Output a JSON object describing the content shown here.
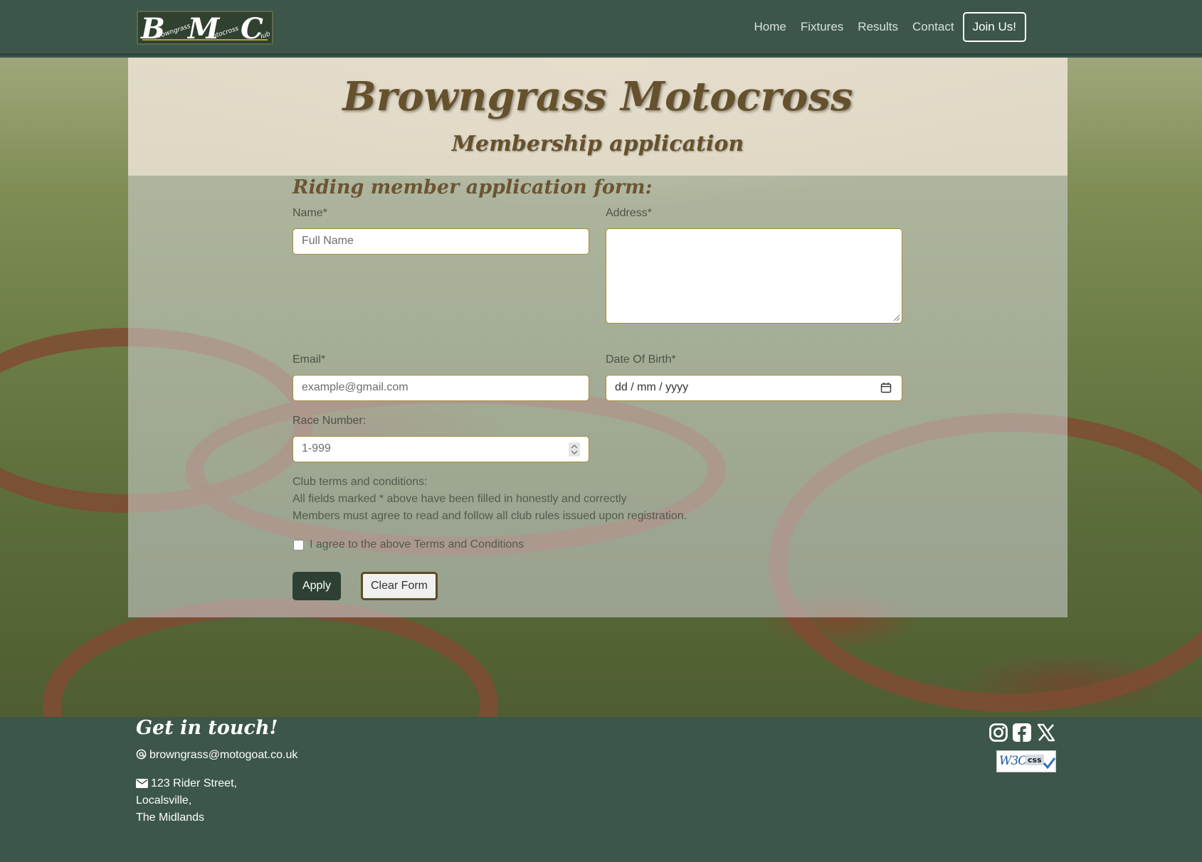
{
  "brand": {
    "logo_B": "B",
    "logo_rowngrass": "rowngrass",
    "logo_M": "M",
    "logo_otocross": "otocross",
    "logo_C": "C",
    "logo_lub": "lub"
  },
  "nav": {
    "links": [
      "Home",
      "Fixtures",
      "Results",
      "Contact"
    ],
    "join_label": "Join Us!"
  },
  "hero": {
    "title": "Browngrass Motocross",
    "subtitle": "Membership application"
  },
  "form": {
    "heading": "Riding member application form:",
    "name_label": "Name*",
    "name_placeholder": "Full Name",
    "address_label": "Address*",
    "email_label": "Email*",
    "email_placeholder": "example@gmail.com",
    "dob_label": "Date Of Birth*",
    "dob_value": "dd / mm / yyyy",
    "race_label": "Race Number:",
    "race_placeholder": "1-999",
    "terms_heading": "Club terms and conditions:",
    "terms_line1": "All fields marked * above have been filled in honestly and correctly",
    "terms_line2": "Members must agree to read and follow all club rules issued upon registration.",
    "agree_label": "I agree to the above Terms and Conditions",
    "apply_label": "Apply",
    "clear_label": "Clear Form"
  },
  "footer": {
    "heading": "Get in touch!",
    "email": "browngrass@motogoat.co.uk",
    "address_line1": "123 Rider Street,",
    "address_line2": "Localsville,",
    "address_line3": "The Midlands",
    "w3c_text": "W3C",
    "css_text": "css"
  },
  "icons": {
    "social": [
      "instagram-icon",
      "facebook-icon",
      "x-twitter-icon"
    ],
    "email": "at-icon",
    "address": "envelope-icon"
  },
  "colors": {
    "nav_bg": "#3c564a",
    "title_brown": "#66512d",
    "apply_bg": "#2d4033",
    "input_border": "#a58b3a"
  }
}
